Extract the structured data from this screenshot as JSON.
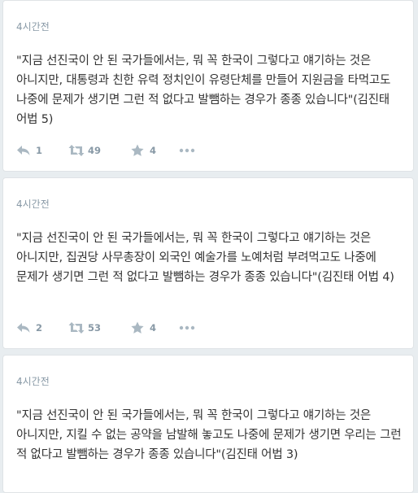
{
  "tweets": [
    {
      "timestamp": "4시간전",
      "text": "\"지금 선진국이 안 된 국가들에서는, 뭐 꼭 한국이 그렇다고 얘기하는 것은 아니지만, 대통령과 친한 유력 정치인이 유령단체를 만들어 지원금을 타먹고도 나중에 문제가 생기면 그런 적 없다고 발뺌하는 경우가 종종 있습니다\"(김진태 어법 5)",
      "reply_count": "1",
      "retweet_count": "49",
      "favorite_count": "4"
    },
    {
      "timestamp": "4시간전",
      "text": "\"지금 선진국이 안 된 국가들에서는, 뭐 꼭 한국이 그렇다고 얘기하는 것은 아니지만, 집권당 사무총장이 외국인 예술가를 노예처럼 부려먹고도 나중에 문제가 생기면 그런 적 없다고 발뺌하는 경우가 종종 있습니다\"(김진태 어법 4)",
      "reply_count": "2",
      "retweet_count": "53",
      "favorite_count": "4"
    },
    {
      "timestamp": "4시간전",
      "text": "\"지금 선진국이 안 된 국가들에서는, 뭐 꼭 한국이 그렇다고 얘기하는 것은 아니지만, 지킬 수 없는 공약을 남발해 놓고도 나중에 문제가 생기면 우리는 그런 적 없다고 발뺌하는 경우가 종종 있습니다\"(김진태 어법 3)"
    }
  ],
  "icons": {
    "reply": "reply-icon",
    "retweet": "retweet-icon",
    "favorite": "star-icon",
    "more": "more-icon"
  },
  "colors": {
    "background": "#e8edf0",
    "card": "#ffffff",
    "text": "#333333",
    "muted": "#8899a6",
    "icon": "#aab8c2"
  }
}
